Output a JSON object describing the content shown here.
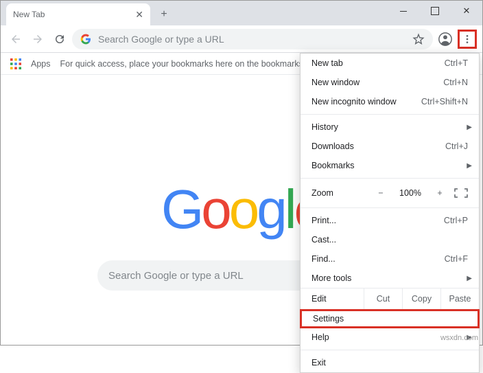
{
  "tab": {
    "title": "New Tab"
  },
  "omnibox": {
    "placeholder": "Search Google or type a URL"
  },
  "bookmarks": {
    "apps_label": "Apps",
    "hint": "For quick access, place your bookmarks here on the bookmarks ba"
  },
  "content": {
    "logo_text": "Google",
    "search_placeholder": "Search Google or type a URL"
  },
  "menu": {
    "new_tab": {
      "label": "New tab",
      "shortcut": "Ctrl+T"
    },
    "new_window": {
      "label": "New window",
      "shortcut": "Ctrl+N"
    },
    "incognito": {
      "label": "New incognito window",
      "shortcut": "Ctrl+Shift+N"
    },
    "history": {
      "label": "History"
    },
    "downloads": {
      "label": "Downloads",
      "shortcut": "Ctrl+J"
    },
    "bookmarks": {
      "label": "Bookmarks"
    },
    "zoom": {
      "label": "Zoom",
      "value": "100%",
      "minus": "−",
      "plus": "+"
    },
    "print": {
      "label": "Print...",
      "shortcut": "Ctrl+P"
    },
    "cast": {
      "label": "Cast..."
    },
    "find": {
      "label": "Find...",
      "shortcut": "Ctrl+F"
    },
    "more_tools": {
      "label": "More tools"
    },
    "edit": {
      "label": "Edit",
      "cut": "Cut",
      "copy": "Copy",
      "paste": "Paste"
    },
    "settings": {
      "label": "Settings"
    },
    "help": {
      "label": "Help"
    },
    "exit": {
      "label": "Exit"
    }
  },
  "watermark": "wsxdn.com"
}
